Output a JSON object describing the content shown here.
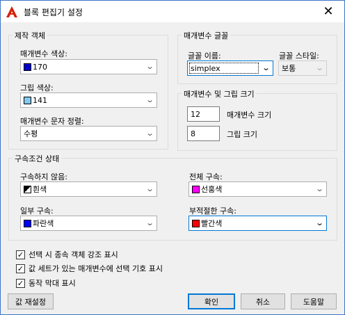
{
  "window": {
    "title": "블록 편집기 설정",
    "close": "✕"
  },
  "drafting": {
    "legend": "제작 객체",
    "param_color_label": "매개변수 색상:",
    "param_color_value": "170",
    "param_color_swatch": "#0000cc",
    "grip_color_label": "그립 색상:",
    "grip_color_value": "141",
    "grip_color_swatch": "#84c8f0",
    "text_align_label": "매개변수 문자 정렬:",
    "text_align_value": "수평"
  },
  "param_font": {
    "legend": "매개변수 글꼴",
    "font_name_label": "글꼴 이름:",
    "font_name_value": "simplex",
    "font_style_label": "글꼴 스타일:",
    "font_style_value": "보통"
  },
  "param_size": {
    "legend": "매개변수 및 그립 크기",
    "param_size_value": "12",
    "param_size_label": "매개변수 크기",
    "grip_size_value": "8",
    "grip_size_label": "그립 크기"
  },
  "constraint": {
    "legend": "구속조건 상태",
    "unconstrained_label": "구속하지 않음:",
    "unconstrained_value": "흰색",
    "full_label": "전체 구속:",
    "full_value": "선홍색",
    "full_swatch": "#ff00ff",
    "partial_label": "일부 구속:",
    "partial_value": "파란색",
    "partial_swatch": "#0000ff",
    "improper_label": "부적절한 구속:",
    "improper_value": "빨간색",
    "improper_swatch": "#ff0000"
  },
  "checks": [
    {
      "label": "선택 시 종속 객체 강조 표시",
      "checked": true
    },
    {
      "label": "값 세트가 있는 매개변수에 선택 기호 표시",
      "checked": true
    },
    {
      "label": "동작 막대 표시",
      "checked": true
    }
  ],
  "buttons": {
    "reset": "값 재설정",
    "ok": "확인",
    "cancel": "취소",
    "help": "도움말"
  }
}
